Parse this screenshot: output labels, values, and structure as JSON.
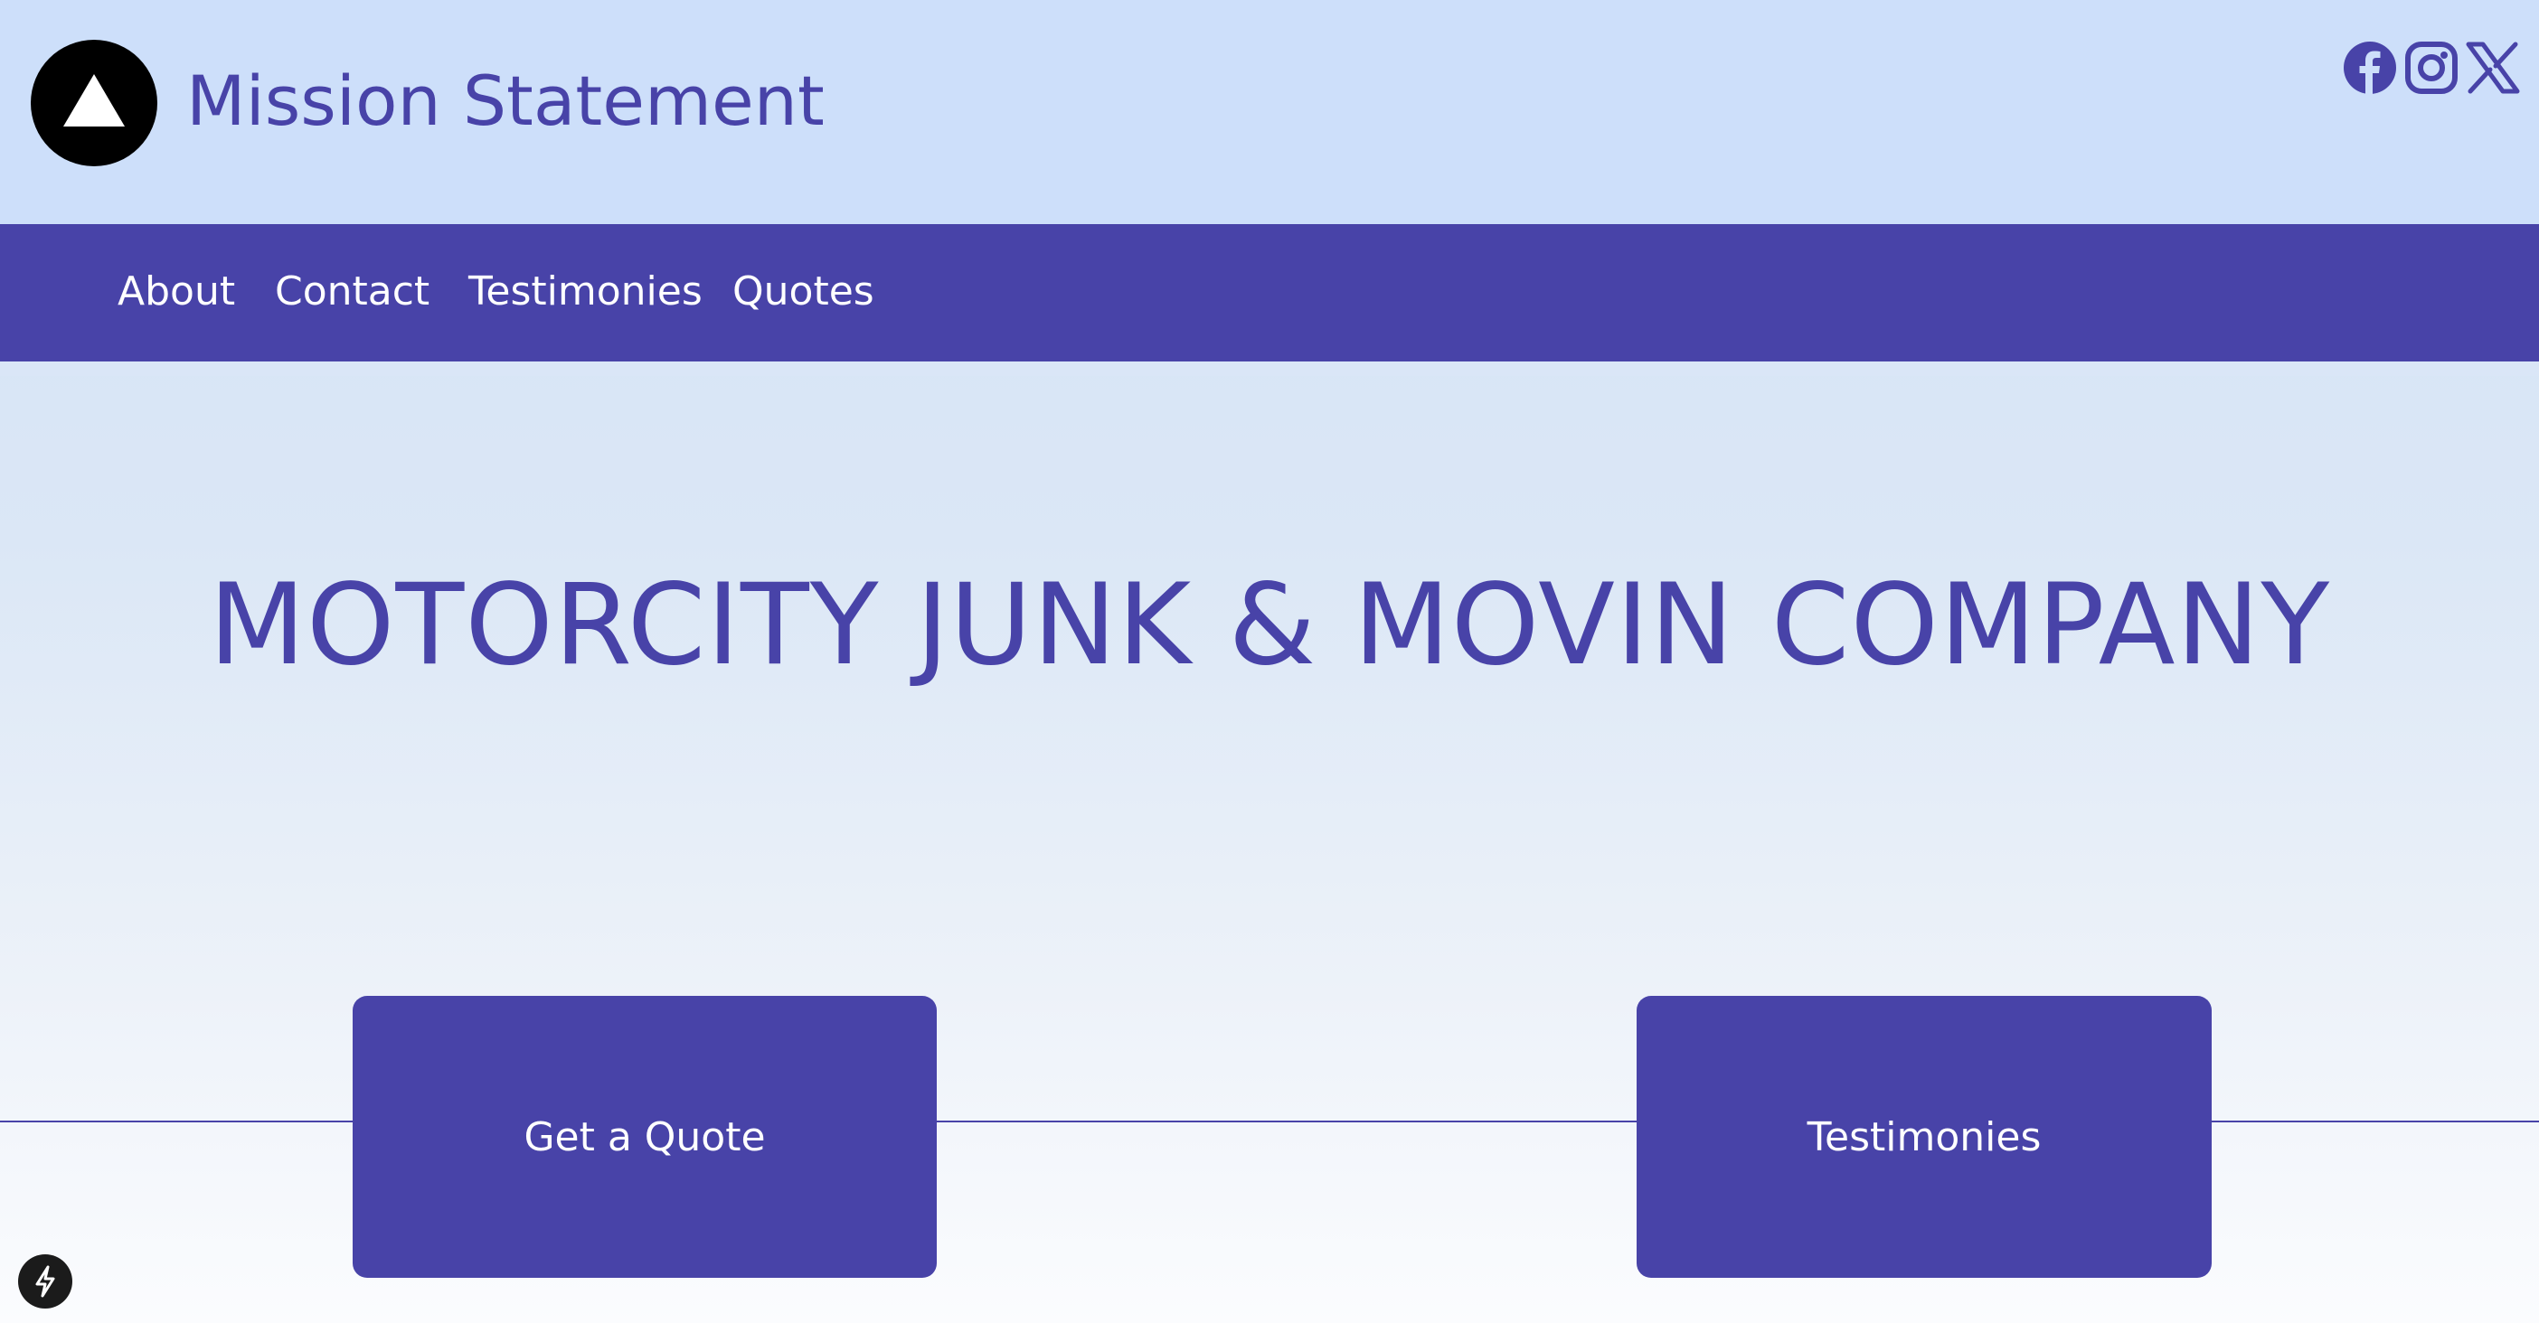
{
  "header": {
    "site_title": "Mission Statement",
    "logo_icon": "triangle-logo-icon",
    "social_icons": [
      "facebook-icon",
      "instagram-icon",
      "x-icon"
    ]
  },
  "nav": {
    "items": [
      {
        "label": "About"
      },
      {
        "label": "Contact"
      },
      {
        "label": "Testimonies"
      },
      {
        "label": "Quotes"
      }
    ]
  },
  "hero": {
    "title": "MOTORCITY JUNK & MOVIN COMPANY",
    "buttons": [
      {
        "label": "Get a Quote"
      },
      {
        "label": "Testimonies"
      }
    ]
  },
  "dev_indicator": {
    "icon": "lightning-icon"
  },
  "colors": {
    "brand": "#4843a8",
    "header_bg": "#cddffa",
    "text_on_brand": "#ffffff"
  }
}
